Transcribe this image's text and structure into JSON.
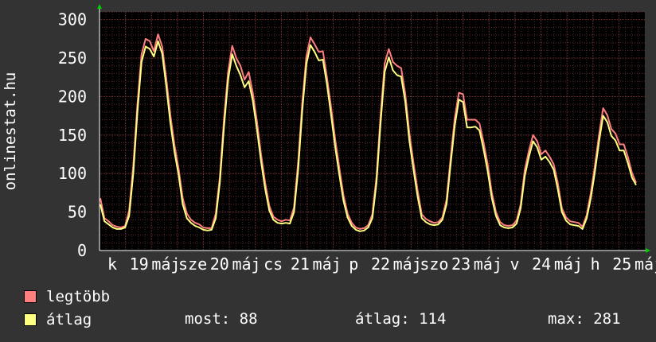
{
  "chart_data": {
    "type": "line",
    "ylabel": "onlinestat.hu",
    "ylim": [
      0,
      310
    ],
    "yticks": [
      0,
      50,
      100,
      150,
      200,
      250,
      300
    ],
    "grid": true,
    "legend_position": "bottom-left",
    "xticks": [
      "k",
      "19",
      "máj",
      "sze",
      "20",
      "máj",
      "cs",
      "21",
      "máj",
      "p",
      "22",
      "máj",
      "szo",
      "23",
      "máj",
      "v",
      "24",
      "máj",
      "h",
      "25",
      "máj"
    ],
    "series": [
      {
        "name": "legtöbb",
        "color": "#ff7f7f",
        "values": [
          68,
          42,
          38,
          33,
          31,
          30,
          32,
          52,
          110,
          190,
          255,
          275,
          272,
          259,
          281,
          265,
          224,
          176,
          137,
          106,
          68,
          48,
          40,
          36,
          34,
          30,
          29,
          29,
          48,
          95,
          170,
          232,
          266,
          250,
          240,
          222,
          232,
          205,
          168,
          125,
          88,
          58,
          44,
          40,
          38,
          40,
          39,
          56,
          115,
          192,
          252,
          277,
          268,
          258,
          259,
          225,
          186,
          144,
          107,
          72,
          48,
          36,
          30,
          28,
          29,
          33,
          47,
          96,
          175,
          243,
          262,
          245,
          240,
          237,
          203,
          152,
          114,
          78,
          47,
          41,
          38,
          36,
          37,
          43,
          66,
          120,
          172,
          205,
          203,
          170,
          170,
          170,
          165,
          140,
          112,
          75,
          50,
          37,
          33,
          32,
          33,
          39,
          60,
          105,
          130,
          150,
          142,
          125,
          130,
          122,
          112,
          88,
          55,
          43,
          38,
          37,
          36,
          31,
          46,
          75,
          110,
          150,
          185,
          176,
          158,
          152,
          138,
          138,
          122,
          101,
          88
        ]
      },
      {
        "name": "átlag",
        "color": "#ffff80",
        "values": [
          60,
          38,
          34,
          30,
          28,
          28,
          30,
          45,
          100,
          180,
          245,
          265,
          262,
          252,
          272,
          256,
          214,
          166,
          128,
          98,
          60,
          42,
          36,
          32,
          30,
          27,
          26,
          27,
          42,
          88,
          160,
          222,
          255,
          240,
          228,
          212,
          220,
          195,
          158,
          116,
          80,
          52,
          40,
          36,
          35,
          36,
          35,
          50,
          105,
          182,
          242,
          267,
          258,
          247,
          248,
          216,
          176,
          134,
          98,
          65,
          43,
          32,
          27,
          25,
          26,
          30,
          42,
          88,
          165,
          232,
          251,
          234,
          228,
          226,
          193,
          142,
          105,
          70,
          42,
          37,
          34,
          33,
          34,
          40,
          60,
          112,
          162,
          196,
          193,
          160,
          160,
          161,
          156,
          131,
          103,
          68,
          45,
          33,
          30,
          29,
          30,
          35,
          55,
          97,
          122,
          142,
          134,
          118,
          122,
          115,
          105,
          80,
          50,
          39,
          34,
          33,
          32,
          28,
          42,
          68,
          102,
          141,
          175,
          167,
          149,
          143,
          130,
          130,
          114,
          95,
          85
        ]
      }
    ]
  },
  "stats": {
    "most_label": "most:",
    "most_value": "88",
    "avg_label": "átlag:",
    "avg_value": "114",
    "max_label": "max:",
    "max_value": "281"
  }
}
